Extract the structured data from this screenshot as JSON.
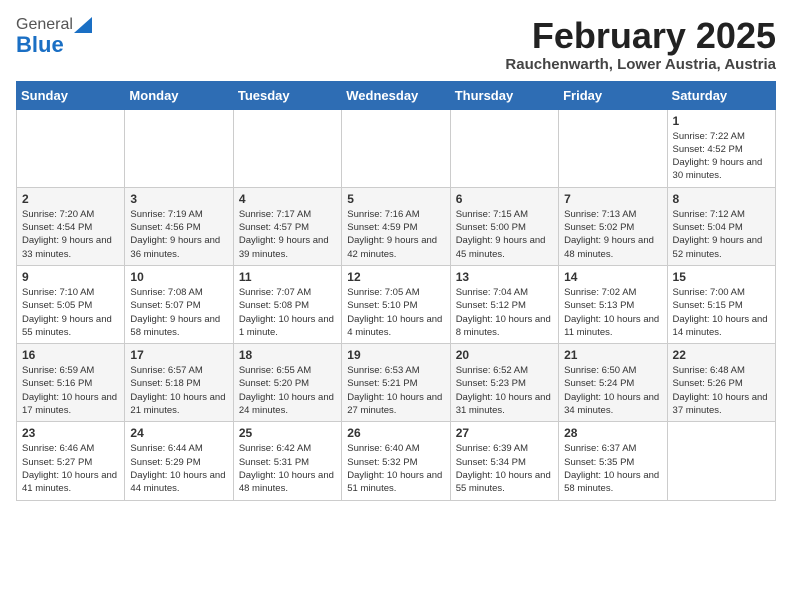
{
  "header": {
    "logo_general": "General",
    "logo_blue": "Blue",
    "month": "February 2025",
    "location": "Rauchenwarth, Lower Austria, Austria"
  },
  "weekdays": [
    "Sunday",
    "Monday",
    "Tuesday",
    "Wednesday",
    "Thursday",
    "Friday",
    "Saturday"
  ],
  "weeks": [
    [
      null,
      null,
      null,
      null,
      null,
      null,
      {
        "day": "1",
        "info": "Sunrise: 7:22 AM\nSunset: 4:52 PM\nDaylight: 9 hours and 30 minutes."
      }
    ],
    [
      {
        "day": "2",
        "info": "Sunrise: 7:20 AM\nSunset: 4:54 PM\nDaylight: 9 hours and 33 minutes."
      },
      {
        "day": "3",
        "info": "Sunrise: 7:19 AM\nSunset: 4:56 PM\nDaylight: 9 hours and 36 minutes."
      },
      {
        "day": "4",
        "info": "Sunrise: 7:17 AM\nSunset: 4:57 PM\nDaylight: 9 hours and 39 minutes."
      },
      {
        "day": "5",
        "info": "Sunrise: 7:16 AM\nSunset: 4:59 PM\nDaylight: 9 hours and 42 minutes."
      },
      {
        "day": "6",
        "info": "Sunrise: 7:15 AM\nSunset: 5:00 PM\nDaylight: 9 hours and 45 minutes."
      },
      {
        "day": "7",
        "info": "Sunrise: 7:13 AM\nSunset: 5:02 PM\nDaylight: 9 hours and 48 minutes."
      },
      {
        "day": "8",
        "info": "Sunrise: 7:12 AM\nSunset: 5:04 PM\nDaylight: 9 hours and 52 minutes."
      }
    ],
    [
      {
        "day": "9",
        "info": "Sunrise: 7:10 AM\nSunset: 5:05 PM\nDaylight: 9 hours and 55 minutes."
      },
      {
        "day": "10",
        "info": "Sunrise: 7:08 AM\nSunset: 5:07 PM\nDaylight: 9 hours and 58 minutes."
      },
      {
        "day": "11",
        "info": "Sunrise: 7:07 AM\nSunset: 5:08 PM\nDaylight: 10 hours and 1 minute."
      },
      {
        "day": "12",
        "info": "Sunrise: 7:05 AM\nSunset: 5:10 PM\nDaylight: 10 hours and 4 minutes."
      },
      {
        "day": "13",
        "info": "Sunrise: 7:04 AM\nSunset: 5:12 PM\nDaylight: 10 hours and 8 minutes."
      },
      {
        "day": "14",
        "info": "Sunrise: 7:02 AM\nSunset: 5:13 PM\nDaylight: 10 hours and 11 minutes."
      },
      {
        "day": "15",
        "info": "Sunrise: 7:00 AM\nSunset: 5:15 PM\nDaylight: 10 hours and 14 minutes."
      }
    ],
    [
      {
        "day": "16",
        "info": "Sunrise: 6:59 AM\nSunset: 5:16 PM\nDaylight: 10 hours and 17 minutes."
      },
      {
        "day": "17",
        "info": "Sunrise: 6:57 AM\nSunset: 5:18 PM\nDaylight: 10 hours and 21 minutes."
      },
      {
        "day": "18",
        "info": "Sunrise: 6:55 AM\nSunset: 5:20 PM\nDaylight: 10 hours and 24 minutes."
      },
      {
        "day": "19",
        "info": "Sunrise: 6:53 AM\nSunset: 5:21 PM\nDaylight: 10 hours and 27 minutes."
      },
      {
        "day": "20",
        "info": "Sunrise: 6:52 AM\nSunset: 5:23 PM\nDaylight: 10 hours and 31 minutes."
      },
      {
        "day": "21",
        "info": "Sunrise: 6:50 AM\nSunset: 5:24 PM\nDaylight: 10 hours and 34 minutes."
      },
      {
        "day": "22",
        "info": "Sunrise: 6:48 AM\nSunset: 5:26 PM\nDaylight: 10 hours and 37 minutes."
      }
    ],
    [
      {
        "day": "23",
        "info": "Sunrise: 6:46 AM\nSunset: 5:27 PM\nDaylight: 10 hours and 41 minutes."
      },
      {
        "day": "24",
        "info": "Sunrise: 6:44 AM\nSunset: 5:29 PM\nDaylight: 10 hours and 44 minutes."
      },
      {
        "day": "25",
        "info": "Sunrise: 6:42 AM\nSunset: 5:31 PM\nDaylight: 10 hours and 48 minutes."
      },
      {
        "day": "26",
        "info": "Sunrise: 6:40 AM\nSunset: 5:32 PM\nDaylight: 10 hours and 51 minutes."
      },
      {
        "day": "27",
        "info": "Sunrise: 6:39 AM\nSunset: 5:34 PM\nDaylight: 10 hours and 55 minutes."
      },
      {
        "day": "28",
        "info": "Sunrise: 6:37 AM\nSunset: 5:35 PM\nDaylight: 10 hours and 58 minutes."
      },
      null
    ]
  ]
}
